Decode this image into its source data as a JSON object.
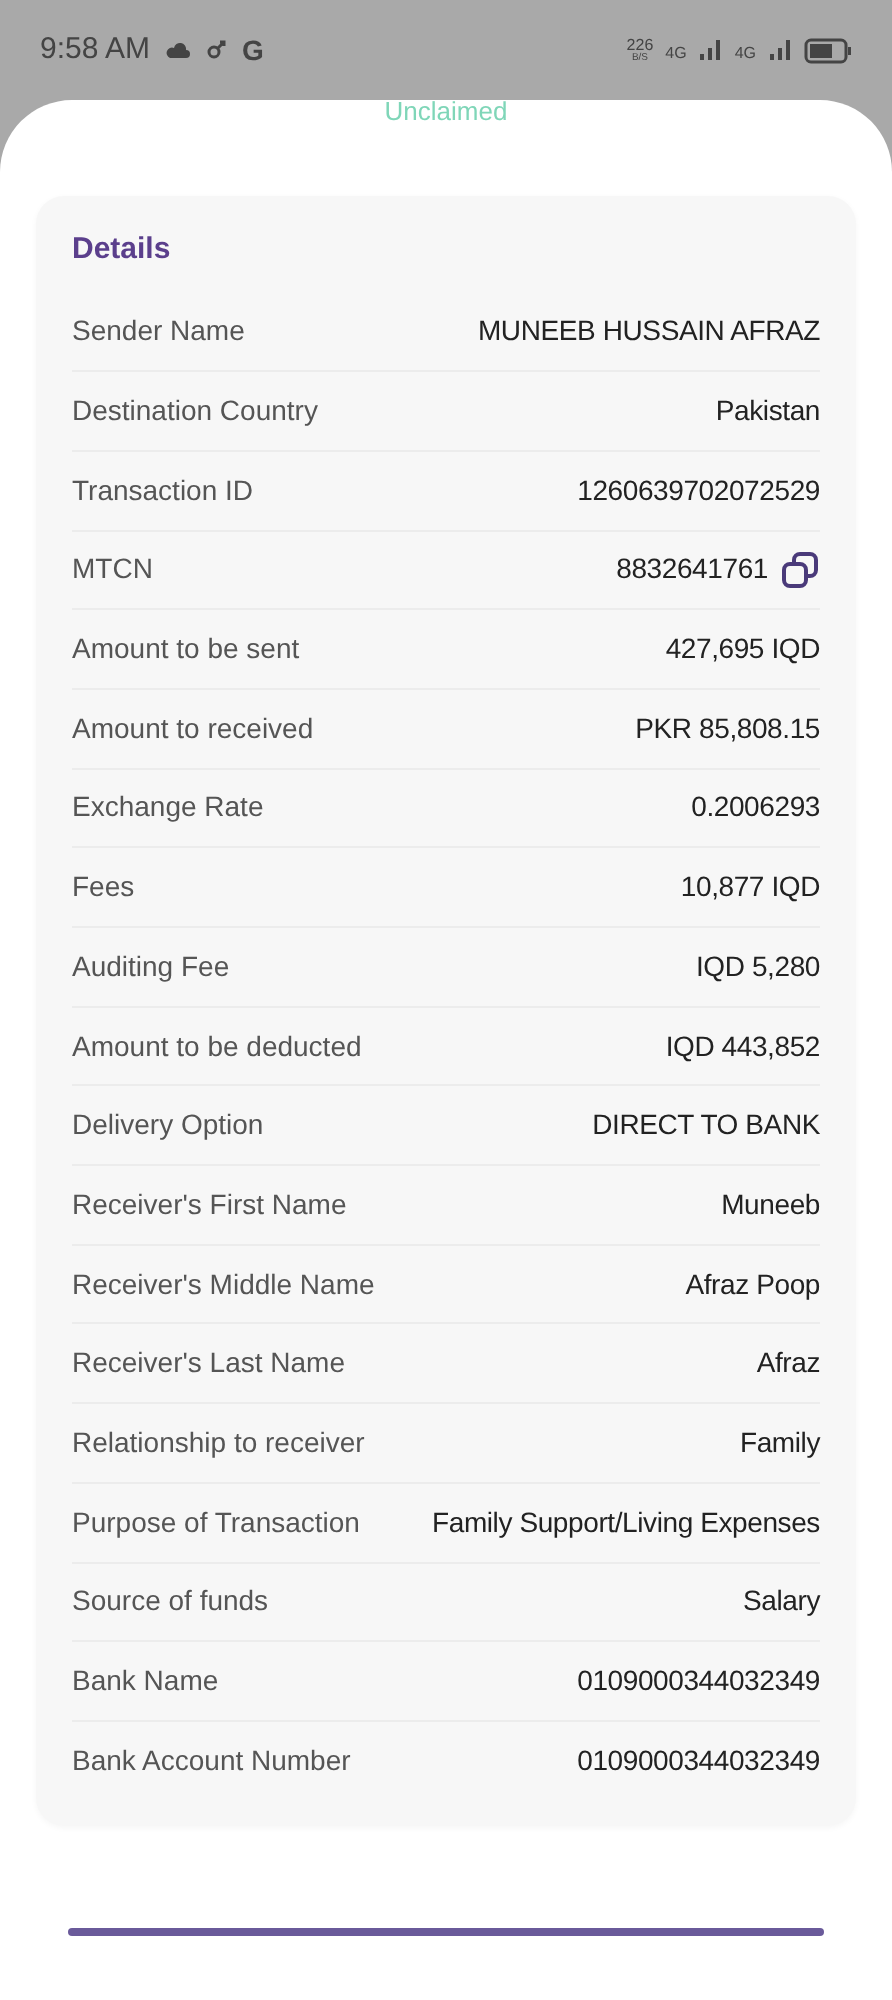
{
  "status_bar": {
    "time": "9:58 AM",
    "g_label": "G",
    "speed": "226",
    "speed_unit": "B/S",
    "net1": "4G",
    "net2": "4G"
  },
  "status_label": "Unclaimed",
  "details": {
    "title": "Details",
    "rows": [
      {
        "label": "Sender Name",
        "value": "MUNEEB HUSSAIN AFRAZ"
      },
      {
        "label": "Destination Country",
        "value": "Pakistan"
      },
      {
        "label": "Transaction ID",
        "value": "1260639702072529"
      },
      {
        "label": "MTCN",
        "value": "8832641761",
        "copyable": true
      },
      {
        "label": "Amount to be sent",
        "value": "427,695 IQD"
      },
      {
        "label": "Amount to received",
        "value": "PKR 85,808.15"
      },
      {
        "label": "Exchange Rate",
        "value": "0.2006293"
      },
      {
        "label": "Fees",
        "value": "10,877 IQD"
      },
      {
        "label": "Auditing Fee",
        "value": "IQD 5,280"
      },
      {
        "label": "Amount to be deducted",
        "value": "IQD 443,852"
      },
      {
        "label": "Delivery Option",
        "value": "DIRECT TO BANK"
      },
      {
        "label": "Receiver's First Name",
        "value": "Muneeb"
      },
      {
        "label": "Receiver's Middle Name",
        "value": "Afraz Poop"
      },
      {
        "label": "Receiver's Last Name",
        "value": "Afraz"
      },
      {
        "label": "Relationship to receiver",
        "value": "Family"
      },
      {
        "label": "Purpose of Transaction",
        "value": "Family Support/Living Expenses"
      },
      {
        "label": "Source of funds",
        "value": "Salary"
      },
      {
        "label": "Bank Name",
        "value": "0109000344032349"
      },
      {
        "label": "Bank Account Number",
        "value": "0109000344032349"
      }
    ]
  }
}
